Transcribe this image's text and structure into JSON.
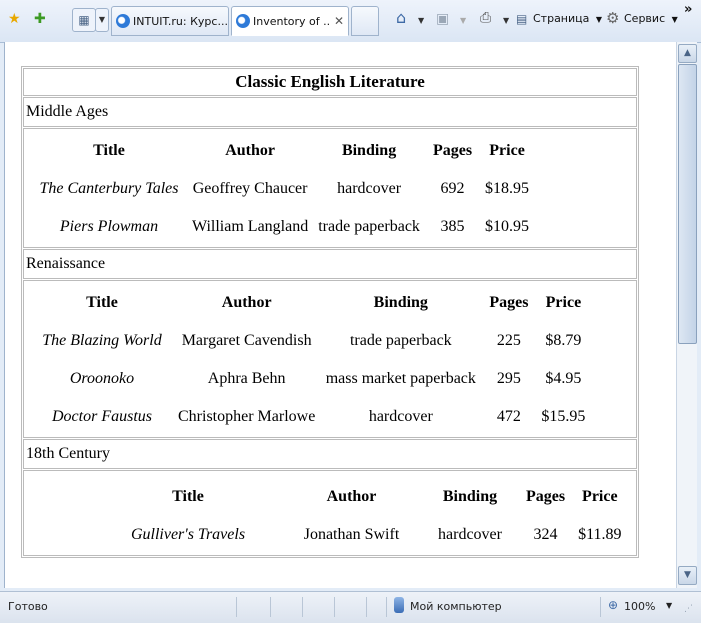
{
  "browser": {
    "tabs": [
      {
        "label": "INTUIT.ru: Курс...",
        "active": false
      },
      {
        "label": "Inventory of ...",
        "active": true
      }
    ],
    "commands": {
      "page": "Страница",
      "service": "Сервис",
      "more": "»"
    },
    "status": {
      "text": "Готово",
      "zone": "Мой компьютер",
      "zoom": "100%"
    }
  },
  "document": {
    "caption": "Classic English Literature",
    "headers": [
      "Title",
      "Author",
      "Binding",
      "Pages",
      "Price"
    ],
    "sections": [
      {
        "name": "Middle Ages",
        "rows": [
          [
            "The Canterbury Tales",
            "Geoffrey Chaucer",
            "hardcover",
            "692",
            "$18.95"
          ],
          [
            "Piers Plowman",
            "William Langland",
            "trade paperback",
            "385",
            "$10.95"
          ]
        ]
      },
      {
        "name": "Renaissance",
        "rows": [
          [
            "The Blazing World",
            "Margaret Cavendish",
            "trade paperback",
            "225",
            "$8.79"
          ],
          [
            "Oroonoko",
            "Aphra Behn",
            "mass market paperback",
            "295",
            "$4.95"
          ],
          [
            "Doctor Faustus",
            "Christopher Marlowe",
            "hardcover",
            "472",
            "$15.95"
          ]
        ]
      },
      {
        "name": "18th Century",
        "rows": [
          [
            "Gulliver's Travels",
            "Jonathan Swift",
            "hardcover",
            "324",
            "$11.89"
          ]
        ]
      }
    ]
  }
}
